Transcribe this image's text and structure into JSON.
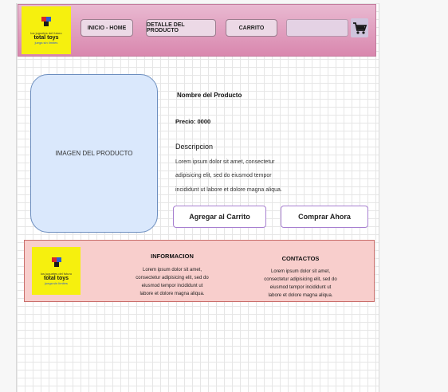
{
  "header": {
    "logo": {
      "top_text": "los juguetes del futuro",
      "brand": "total toys",
      "sub_text": "juega sin límites"
    },
    "nav": [
      {
        "label": "INICIO - HOME"
      },
      {
        "label": "DETALLE DEL PRODUCTO"
      },
      {
        "label": "CARRITO"
      }
    ],
    "search": {
      "value": ""
    },
    "cart_icon": "shopping-cart-icon"
  },
  "product": {
    "image_label": "IMAGEN DEL PRODUCTO",
    "name": "Nombre del Producto",
    "price": "Precio: 0000",
    "description_title": "Descripcion",
    "description_lines": [
      "Lorem ipsum dolor sit amet, consectetur",
      "adipisicing elit, sed do eiusmod tempor",
      "incididunt ut labore et dolore magna aliqua."
    ],
    "add_to_cart": "Agregar al Carrito",
    "buy_now": "Comprar Ahora"
  },
  "footer": {
    "info": {
      "title": "INFORMACION",
      "lines": [
        "Lorem ipsum dolor sit amet,",
        "consectetur adipisicing elit, sed do",
        "eiusmod tempor incididunt ut",
        "labore et dolore magna aliqua."
      ]
    },
    "contact": {
      "title": "CONTACTOS",
      "lines": [
        "Lorem ipsum dolor sit amet,",
        "consectetur adipisicing elit, sed do",
        "eiusmod tempor incididunt ut",
        "labore et dolore magna aliqua."
      ]
    }
  },
  "colors": {
    "header_gradient_top": "#e9b9d1",
    "header_gradient_bottom": "#d987ae",
    "logo_bg": "#f6f00e",
    "image_box": "#dae8fc",
    "footer_bg": "#f8cecc",
    "button_border": "#a77fd0"
  }
}
